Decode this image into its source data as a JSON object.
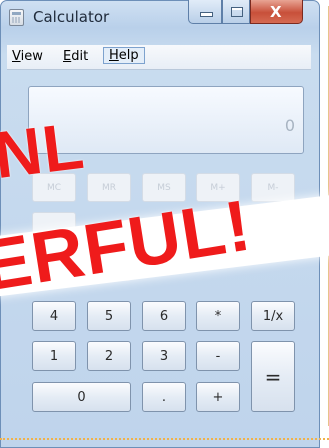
{
  "window": {
    "title": "Calculator",
    "controls": {
      "minimize": "minimize",
      "maximize": "maximize",
      "close": "X"
    }
  },
  "menu": {
    "items": [
      {
        "label": "View",
        "mnemonic": "V",
        "rest": "iew"
      },
      {
        "label": "Edit",
        "mnemonic": "E",
        "rest": "dit"
      },
      {
        "label": "Help",
        "mnemonic": "H",
        "rest": "elp"
      }
    ]
  },
  "display": {
    "value": "0"
  },
  "memory_keys": [
    "MC",
    "MR",
    "MS",
    "M+",
    "M-"
  ],
  "keys": {
    "k4": "4",
    "k5": "5",
    "k6": "6",
    "mul": "*",
    "recip": "1/x",
    "k1": "1",
    "k2": "2",
    "k3": "3",
    "sub": "-",
    "equals": "=",
    "k0": "0",
    "dot": ".",
    "add": "+"
  },
  "overlay": {
    "line1": "NL",
    "line2": "ERFUL!"
  },
  "colors": {
    "overlay_text": "#ef1b1b",
    "frame": "#bfd4ec",
    "close_button": "#c8503a"
  }
}
